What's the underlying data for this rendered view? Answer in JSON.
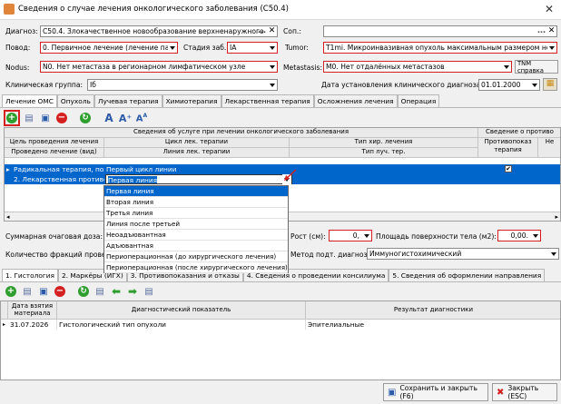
{
  "window": {
    "title": "Сведения о случае лечения онкологического заболевания (C50.4)"
  },
  "form": {
    "diagnosis_label": "Диагноз:",
    "diagnosis_value": "C50.4. Злокачественное новообразование верхненаружного",
    "sop_label": "Соп.:",
    "sop_value": "",
    "povod_label": "Повод:",
    "povod_value": "0. Первичное лечение (лечение па",
    "stage_label": "Стадия заб.:",
    "stage_value": "IA",
    "tumor_label": "Tumor:",
    "tumor_value": "T1mi. Микроинвазивная опухоль максимальным размером не б",
    "nodus_label": "Nodus:",
    "nodus_value": "N0. Нет метастаза в регионарном лимфатическом узле",
    "metastasis_label": "Metastasis:",
    "metastasis_value": "M0. Нет отдалённых метастазов",
    "tnm_button": "TNM справка",
    "clinical_group_label": "Клиническая группа:",
    "clinical_group_value": "Iб",
    "date_label": "Дата установления клинического диагноза:",
    "date_value": "01.01.2000"
  },
  "main_tabs": [
    "Лечение ОМС",
    "Опухоль",
    "Лучевая терапия",
    "Химиотерапия",
    "Лекарственная терапия",
    "Осложнения лечения",
    "Операция"
  ],
  "grid1": {
    "group_header": "Сведения об услуге при лечении онкологического заболевания",
    "group_header_right": "Сведение о противо",
    "col1_a": "Цель проведения лечения",
    "col1_b": "Проведено лечение (вид)",
    "col2_a": "Цикл лек. терапии",
    "col2_b": "Линия лек. терапии",
    "col3_a": "Тип хир. лечения",
    "col3_b": "Тип луч. тер.",
    "col4_a": "Противопоказ",
    "col4_b": "терапия",
    "col5": "Не",
    "rows": [
      {
        "c1": "Радикальная терапия, полн",
        "c2": "Первый цикл линии"
      },
      {
        "c1": "2. Лекарственная противоо",
        "c2": "Первая линия"
      }
    ]
  },
  "dropdown_options": [
    "Первая линия",
    "Вторая линия",
    "Третья линия",
    "Линия после третьей",
    "Неоадъювантная",
    "Адъювантная",
    "Периоперационная (до хирургического лечения)",
    "Периоперационная (после хирургического лечения)"
  ],
  "mid": {
    "dose_label": "Суммарная очаговая доза:",
    "height_label": "Рост (см):",
    "height_value": "0,",
    "area_label": "Площадь поверхности тела (м2):",
    "area_value": "0,00.",
    "fractions_label": "Количество фракций провед",
    "method_label": "Метод подт. диагноза:",
    "method_value": "Иммуногистохимический"
  },
  "lower_tabs": [
    "1. Гистология",
    "2. Маркёры (ИГХ)",
    "3. Противопоказания и отказы",
    "4. Сведения о проведении консилиума",
    "5. Сведения об оформлении направления"
  ],
  "grid2": {
    "col1": "Дата взятия материала",
    "col2": "Диагностический показатель",
    "col3": "Результат диагностики",
    "rows": [
      {
        "date": "31.07.2026",
        "indicator": "Гистологический тип опухоли",
        "result": "Эпителиальные"
      }
    ]
  },
  "buttons": {
    "save": "Сохранить и закрыть (F6)",
    "close": "Закрыть (ESC)"
  },
  "colors": {
    "accent": "#0066cc",
    "required": "#d42020",
    "add_green": "#2e9e2e"
  }
}
